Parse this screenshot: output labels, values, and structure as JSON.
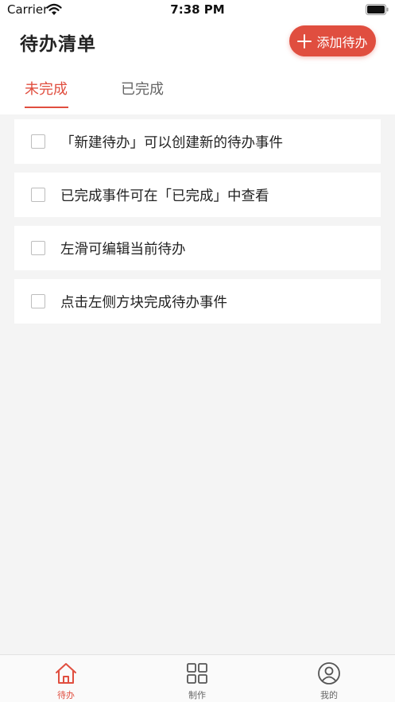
{
  "status_bar": {
    "carrier": "Carrier",
    "time": "7:38 PM"
  },
  "header": {
    "title": "待办清单",
    "add_button_label": "添加待办"
  },
  "tabs": {
    "active": "未完成",
    "inactive": "已完成"
  },
  "todos": [
    {
      "text": "「新建待办」可以创建新的待办事件",
      "checked": false
    },
    {
      "text": "已完成事件可在「已完成」中查看",
      "checked": false
    },
    {
      "text": "左滑可编辑当前待办",
      "checked": false
    },
    {
      "text": "点击左侧方块完成待办事件",
      "checked": false
    }
  ],
  "bottom_nav": [
    {
      "label": "待办",
      "icon": "home-icon",
      "active": true
    },
    {
      "label": "制作",
      "icon": "grid-icon",
      "active": false
    },
    {
      "label": "我的",
      "icon": "user-icon",
      "active": false
    }
  ],
  "colors": {
    "accent": "#e04e3f",
    "background": "#f4f4f4",
    "card": "#ffffff"
  }
}
